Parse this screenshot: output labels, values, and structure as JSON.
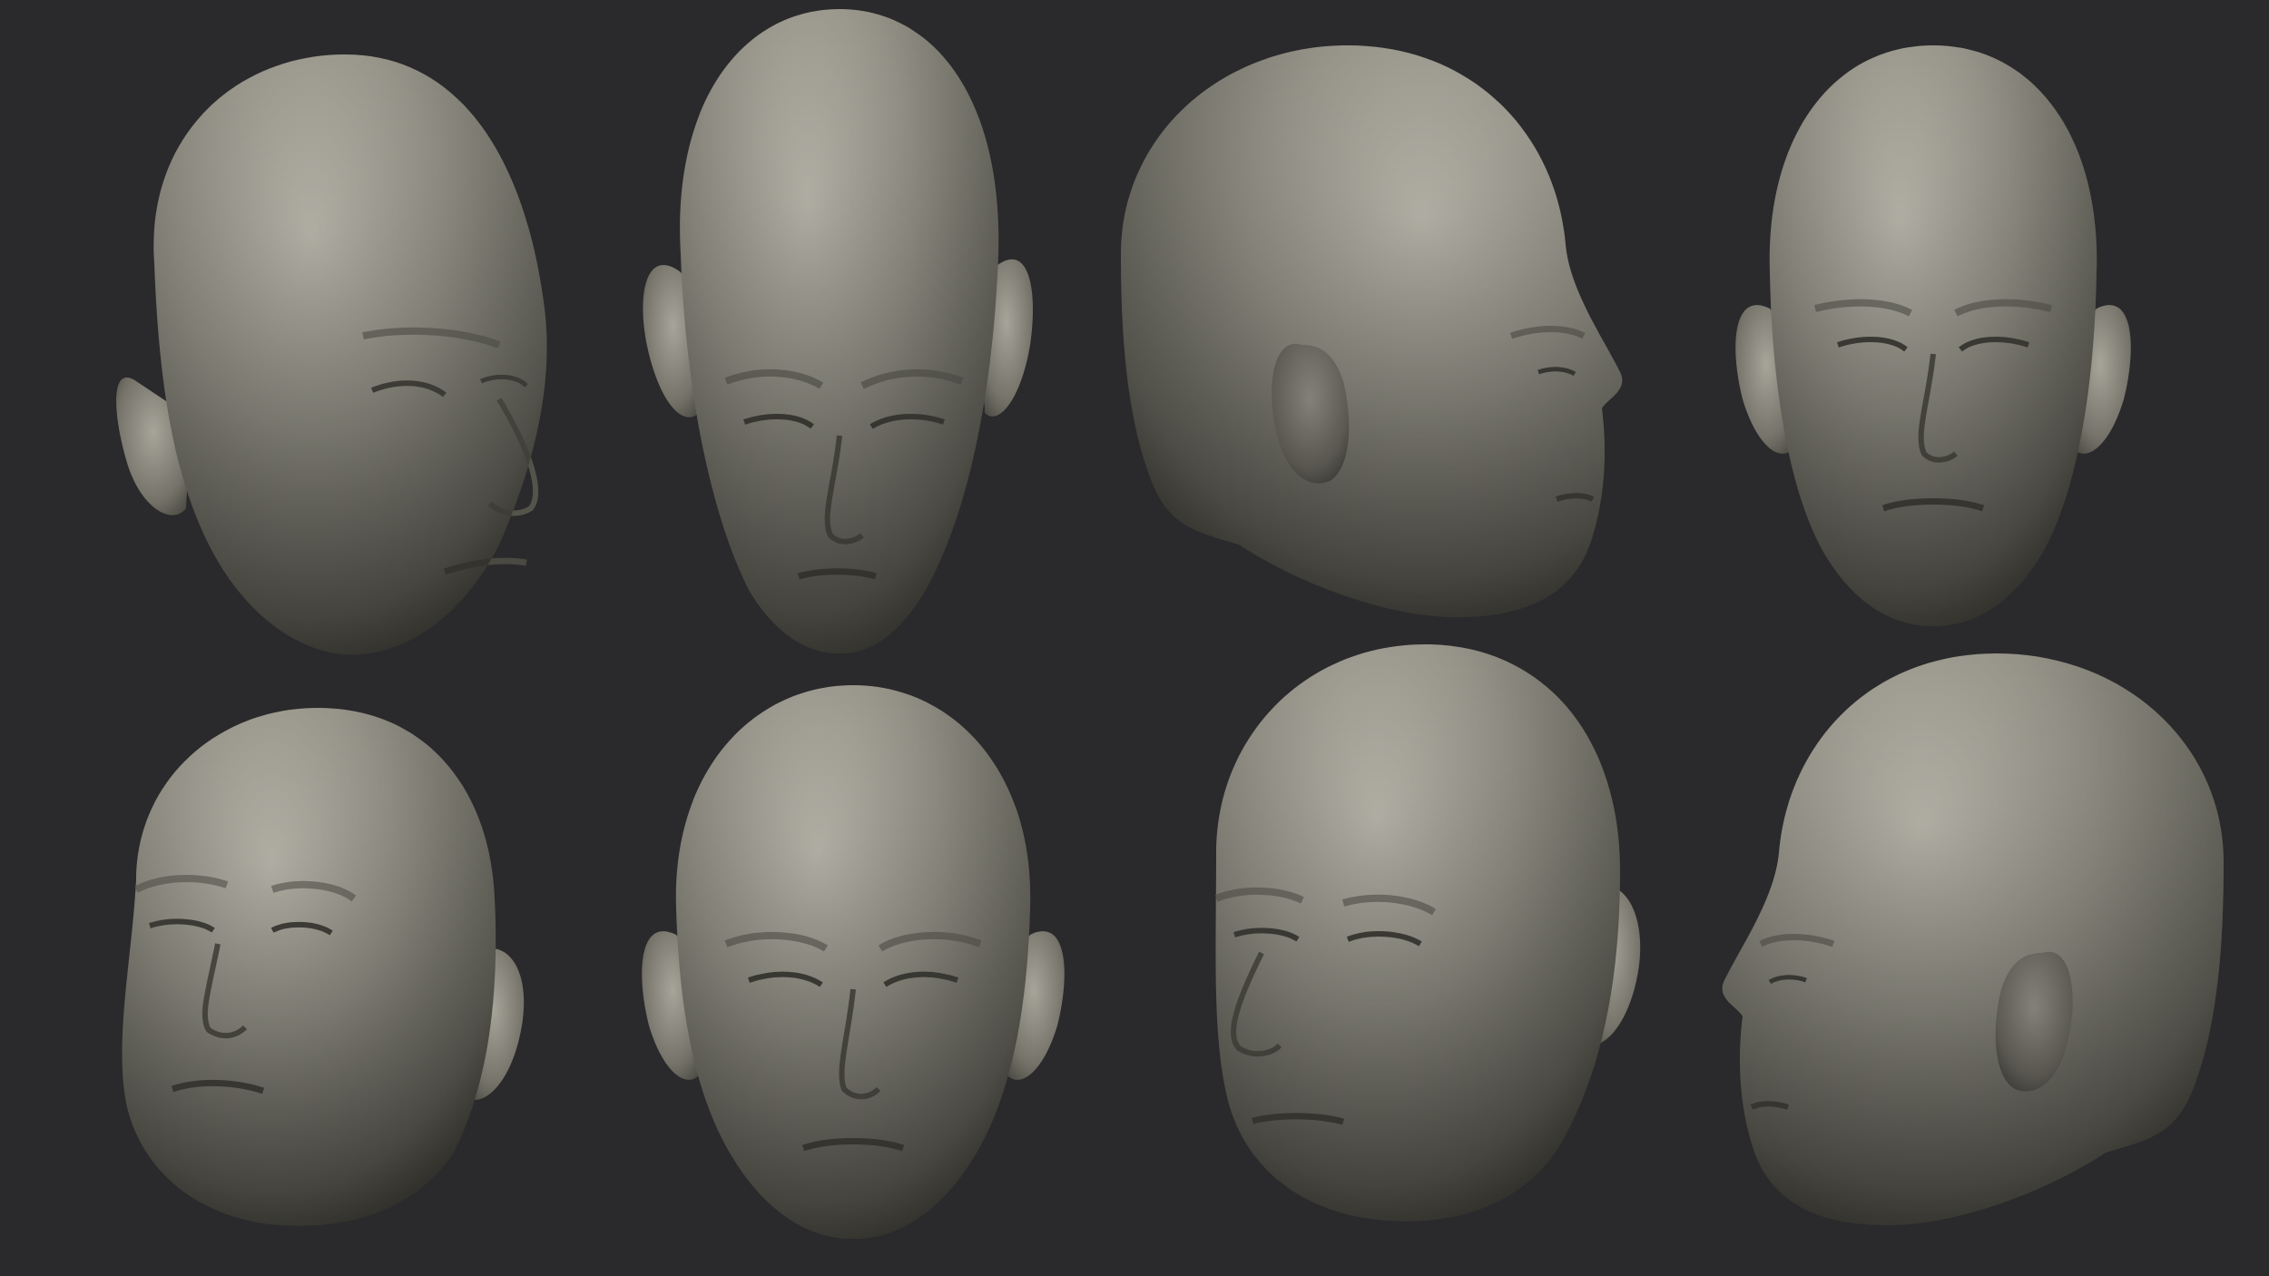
{
  "scene": {
    "background_color": "#2a2a2c",
    "material_color": "#8e8c80",
    "material_highlight": "#bdbbb0",
    "material_shadow": "#4a4942",
    "views": [
      {
        "name": "three-quarter-right-high"
      },
      {
        "name": "front-looking-down"
      },
      {
        "name": "right-profile-back"
      },
      {
        "name": "front"
      },
      {
        "name": "three-quarter-left-low"
      },
      {
        "name": "front-low"
      },
      {
        "name": "three-quarter-left"
      },
      {
        "name": "left-profile-back"
      }
    ]
  }
}
